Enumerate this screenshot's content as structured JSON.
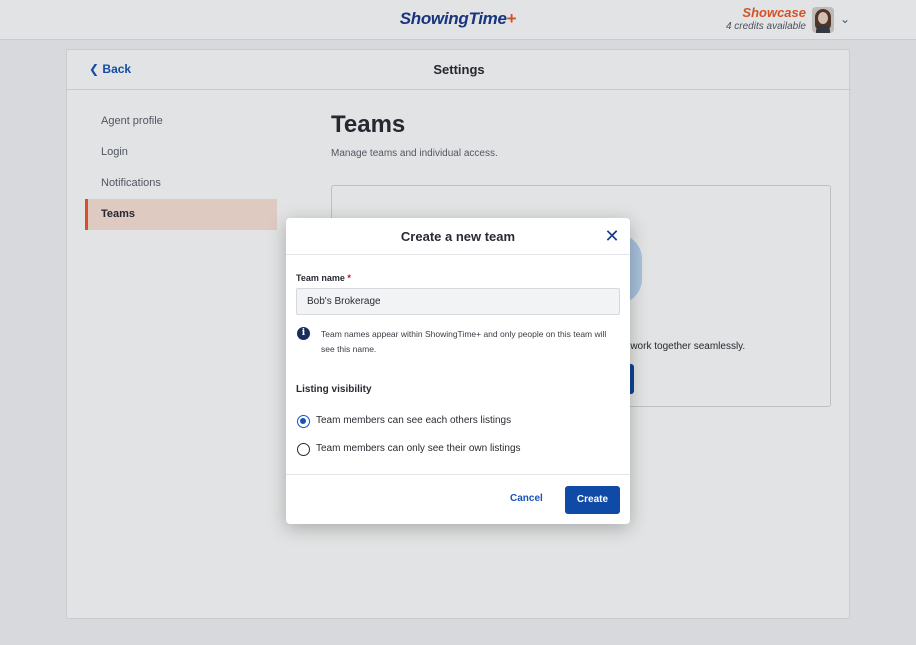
{
  "header": {
    "brand": "ShowingTime",
    "brand_plus": "+",
    "account_name": "Showcase",
    "credits": "4 credits available"
  },
  "settings": {
    "back_label": "Back",
    "title": "Settings",
    "nav": [
      {
        "label": "Agent profile",
        "active": false
      },
      {
        "label": "Login",
        "active": false
      },
      {
        "label": "Notifications",
        "active": false
      },
      {
        "label": "Teams",
        "active": true
      }
    ],
    "heading": "Teams",
    "subheading": "Manage teams and individual access.",
    "panel_text_partial": "n work together seamlessly."
  },
  "modal": {
    "title": "Create a new team",
    "team_name_label": "Team name",
    "required_mark": "*",
    "team_name_value": "Bob's Brokerage",
    "info_icon_glyph": "i",
    "info_text": "Team names appear within ShowingTime+ and only people on this team will see this name.",
    "visibility_title": "Listing visibility",
    "options": [
      {
        "label": "Team members can see each others listings",
        "checked": true
      },
      {
        "label": "Team members can only see their own listings",
        "checked": false
      }
    ],
    "cancel_label": "Cancel",
    "create_label": "Create"
  },
  "icons": {
    "back": "chevron-left-icon",
    "close": "close-icon",
    "account_menu": "chevron-down-icon",
    "info": "info-icon"
  },
  "colors": {
    "brand_blue": "#1a3a8a",
    "accent_orange": "#f05a28",
    "primary_button": "#0f4ba6",
    "link_blue": "#1553b8",
    "active_nav_bg": "#fbe3d8"
  }
}
